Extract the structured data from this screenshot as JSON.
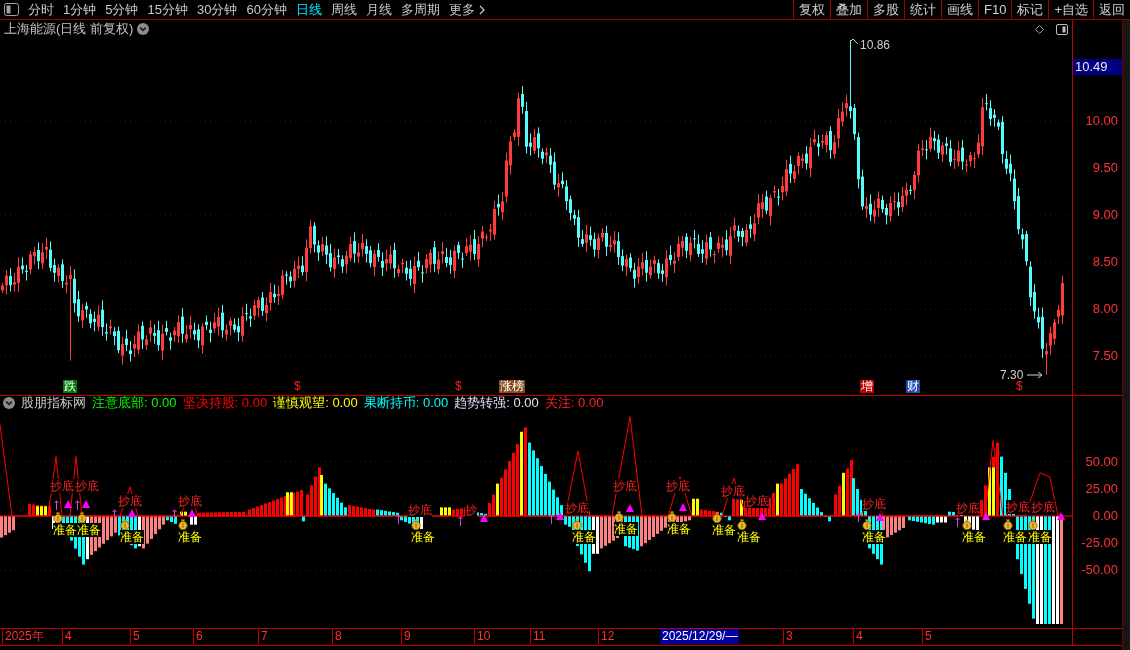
{
  "toolbar": {
    "periods": [
      {
        "label": "分时",
        "selected": false
      },
      {
        "label": "1分钟",
        "selected": false
      },
      {
        "label": "5分钟",
        "selected": false
      },
      {
        "label": "15分钟",
        "selected": false
      },
      {
        "label": "30分钟",
        "selected": false
      },
      {
        "label": "60分钟",
        "selected": false
      },
      {
        "label": "日线",
        "selected": true
      },
      {
        "label": "周线",
        "selected": false
      },
      {
        "label": "月线",
        "selected": false
      },
      {
        "label": "多周期",
        "selected": false
      }
    ],
    "more": "更多",
    "buttons": [
      "复权",
      "叠加",
      "多股",
      "统计",
      "画线",
      "F10",
      "标记",
      "+自选",
      "返回"
    ]
  },
  "chart": {
    "title": "上海能源(日线 前复权)",
    "current_price": "10.49",
    "price_axis": [
      "10.00",
      "9.50",
      "9.00",
      "8.50",
      "8.00",
      "7.50"
    ],
    "high_mark": "10.86",
    "low_mark": "7.30",
    "event_tags": [
      {
        "kind": "fall",
        "label": "跌"
      },
      {
        "kind": "dollar",
        "label": "$"
      },
      {
        "kind": "dollar",
        "label": "$"
      },
      {
        "kind": "limit-up",
        "label": "涨榜"
      },
      {
        "kind": "increase",
        "label": "增"
      },
      {
        "kind": "finance",
        "label": "财"
      },
      {
        "kind": "dollar",
        "label": "$"
      }
    ]
  },
  "indicator": {
    "name": "股朋指标网",
    "readings": [
      {
        "label": "注意底部:",
        "value": "0.00",
        "color": "#00ff00"
      },
      {
        "label": "坚决持股:",
        "value": "0.00",
        "color": "#ff0000"
      },
      {
        "label": "谨慎观望:",
        "value": "0.00",
        "color": "#ffff00"
      },
      {
        "label": "果断持币:",
        "value": "0.00",
        "color": "#00ffff"
      },
      {
        "label": "趋势转强:",
        "value": "0.00",
        "color": "#e8e0f8"
      },
      {
        "label": "关注:",
        "value": "0.00",
        "color": "#ff2020"
      }
    ],
    "axis": [
      "50.00",
      "25.00",
      "0.00",
      "-25.00",
      "-50.00"
    ],
    "bottom_signals": [
      "抄底",
      "抄底",
      "抄底",
      "抄底",
      "抄底",
      "抄",
      "抄底",
      "抄底",
      "抄底",
      "抄底",
      "抄底",
      "抄底",
      "抄底",
      "抄底",
      "抄底"
    ],
    "ready_signals": [
      "准备",
      "准备",
      "准备",
      "准备",
      "准备",
      "准备",
      "准备",
      "准备",
      "准备",
      "准备",
      "准备",
      "准备",
      "准备",
      "准备"
    ]
  },
  "time_axis": {
    "labels": [
      "2025年",
      "4",
      "5",
      "6",
      "7",
      "8",
      "9",
      "10",
      "11",
      "12",
      "3",
      "4",
      "5"
    ],
    "cursor_date": "2025/12/29/—"
  }
}
